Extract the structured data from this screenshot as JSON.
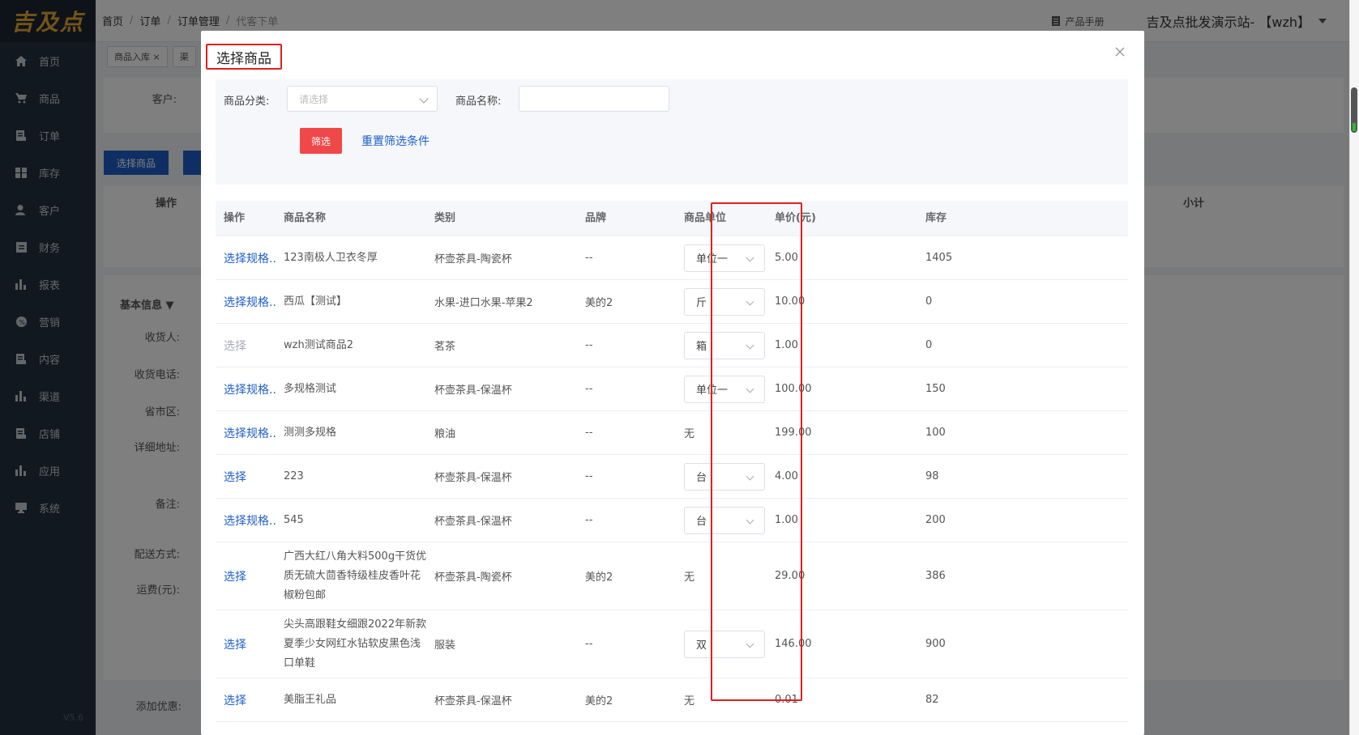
{
  "sidebar": {
    "logo": "吉及点",
    "items": [
      {
        "label": "首页",
        "icon": "home-icon"
      },
      {
        "label": "商品",
        "icon": "cart-icon"
      },
      {
        "label": "订单",
        "icon": "order-icon"
      },
      {
        "label": "库存",
        "icon": "grid-icon"
      },
      {
        "label": "客户",
        "icon": "user-icon"
      },
      {
        "label": "财务",
        "icon": "finance-icon"
      },
      {
        "label": "报表",
        "icon": "bar-chart-icon"
      },
      {
        "label": "营销",
        "icon": "marketing-icon"
      },
      {
        "label": "内容",
        "icon": "content-icon"
      },
      {
        "label": "渠道",
        "icon": "bar-chart-icon"
      },
      {
        "label": "店铺",
        "icon": "store-icon"
      },
      {
        "label": "应用",
        "icon": "bar-chart-icon"
      },
      {
        "label": "系统",
        "icon": "monitor-icon"
      }
    ],
    "version": "V5.6"
  },
  "header": {
    "breadcrumb": [
      "首页",
      "订单",
      "订单管理",
      "代客下单"
    ],
    "manual": "产品手册",
    "site": "吉及点批发演示站- 【wzh】"
  },
  "tabs": [
    "商品入库 ×",
    "渠"
  ],
  "background": {
    "customer_label": "客户:",
    "select_goods_button": "选择商品",
    "op_header": "操作",
    "subtotal_header": "小计",
    "basic_info": "基本信息 ▼",
    "fields": [
      "收货人:",
      "收货电话:",
      "省市区:",
      "详细地址:",
      "备注:",
      "配送方式:",
      "运费(元):"
    ],
    "add_discount": "添加优惠:"
  },
  "modal": {
    "title": "选择商品",
    "filter": {
      "category_label": "商品分类:",
      "category_placeholder": "请选择",
      "name_label": "商品名称:",
      "filter_button": "筛选",
      "reset_link": "重置筛选条件"
    },
    "table": {
      "columns": [
        "操作",
        "商品名称",
        "类别",
        "品牌",
        "商品单位",
        "单价(元)",
        "库存"
      ],
      "rows": [
        {
          "op": "选择规格..",
          "name": "123南极人卫衣冬厚",
          "category": "杯壶茶具-陶瓷杯",
          "brand": "--",
          "unit": "单位一",
          "unit_select": true,
          "price": "5.00",
          "stock": "1405"
        },
        {
          "op": "选择规格..",
          "name": "西瓜【测试】",
          "category": "水果-进口水果-苹果2",
          "brand": "美的2",
          "unit": "斤",
          "unit_select": true,
          "price": "10.00",
          "stock": "0"
        },
        {
          "op": "选择",
          "op_disabled": true,
          "name": "wzh测试商品2",
          "category": "茗茶",
          "brand": "--",
          "unit": "箱",
          "unit_select": true,
          "price": "1.00",
          "stock": "0"
        },
        {
          "op": "选择规格..",
          "name": "多规格测试",
          "category": "杯壶茶具-保温杯",
          "brand": "--",
          "unit": "单位一",
          "unit_select": true,
          "price": "100.00",
          "stock": "150"
        },
        {
          "op": "选择规格..",
          "name": "测测多规格",
          "category": "粮油",
          "brand": "--",
          "unit": "无",
          "unit_select": false,
          "price": "199.00",
          "stock": "100"
        },
        {
          "op": "选择",
          "name": "223",
          "category": "杯壶茶具-保温杯",
          "brand": "--",
          "unit": "台",
          "unit_select": true,
          "price": "4.00",
          "stock": "98"
        },
        {
          "op": "选择规格..",
          "name": "545",
          "category": "杯壶茶具-保温杯",
          "brand": "--",
          "unit": "台",
          "unit_select": true,
          "price": "1.00",
          "stock": "200"
        },
        {
          "op": "选择",
          "name": "广西大红八角大料500g干货优质无硫大茴香特级桂皮香叶花椒粉包邮",
          "category": "杯壶茶具-陶瓷杯",
          "brand": "美的2",
          "unit": "无",
          "unit_select": false,
          "price": "29.00",
          "stock": "386"
        },
        {
          "op": "选择",
          "name": "尖头高跟鞋女细跟2022年新款夏季少女网红水钻软皮黑色浅口单鞋",
          "category": "服装",
          "brand": "--",
          "unit": "双",
          "unit_select": true,
          "price": "146.00",
          "stock": "900"
        },
        {
          "op": "选择",
          "name": "美脂王礼品",
          "category": "杯壶茶具-保温杯",
          "brand": "美的2",
          "unit": "无",
          "unit_select": false,
          "price": "0.01",
          "stock": "82"
        }
      ]
    }
  }
}
